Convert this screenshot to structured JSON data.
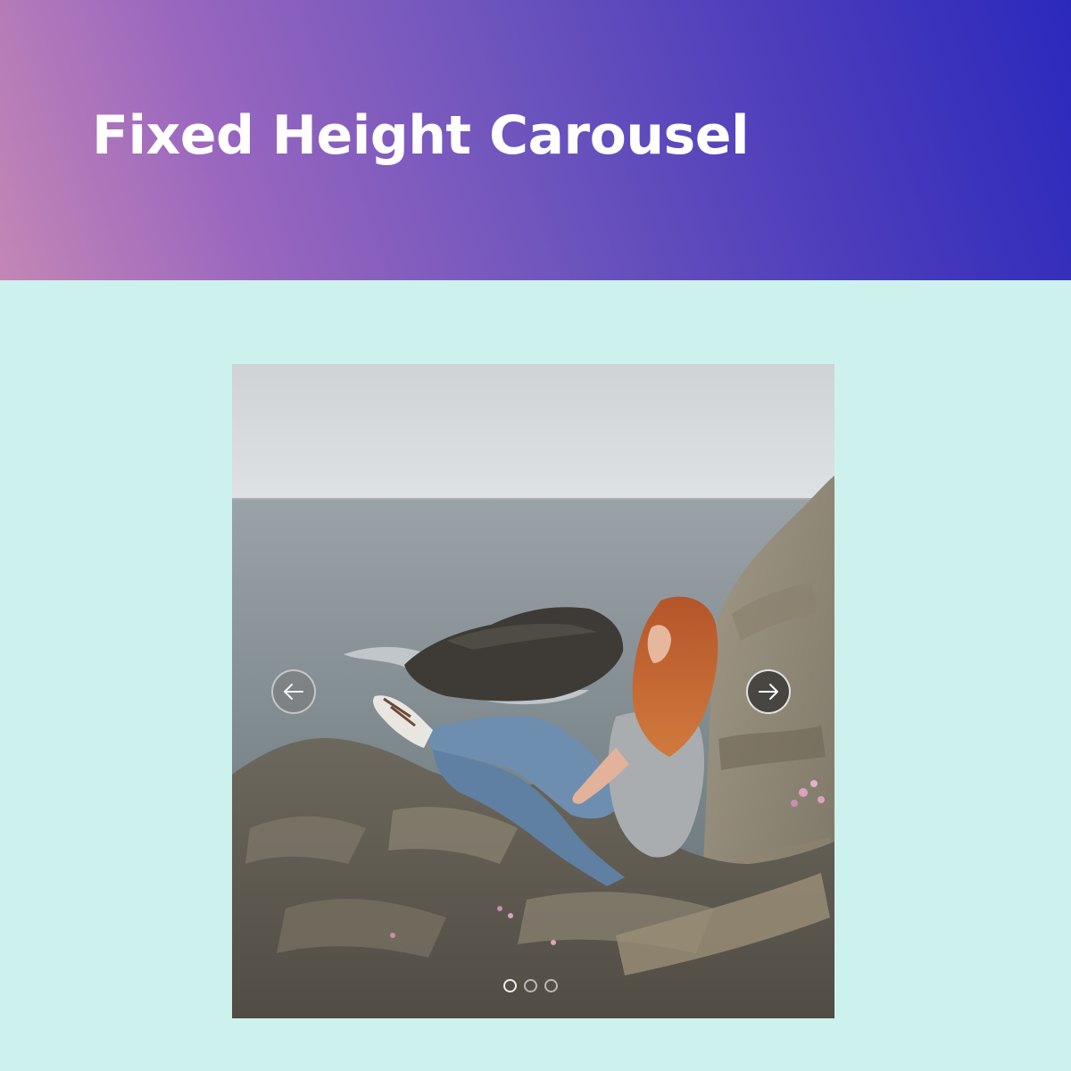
{
  "header": {
    "title": "Fixed Height Carousel"
  },
  "carousel": {
    "current_slide": 1,
    "slide_count": 3,
    "prev_icon": "arrow-left-icon",
    "next_icon": "arrow-right-icon"
  },
  "colors": {
    "page_background": "#cdf2ee",
    "header_gradient_start": "#c386b5",
    "header_gradient_end": "#2b29bd",
    "title_text": "#ffffff"
  }
}
